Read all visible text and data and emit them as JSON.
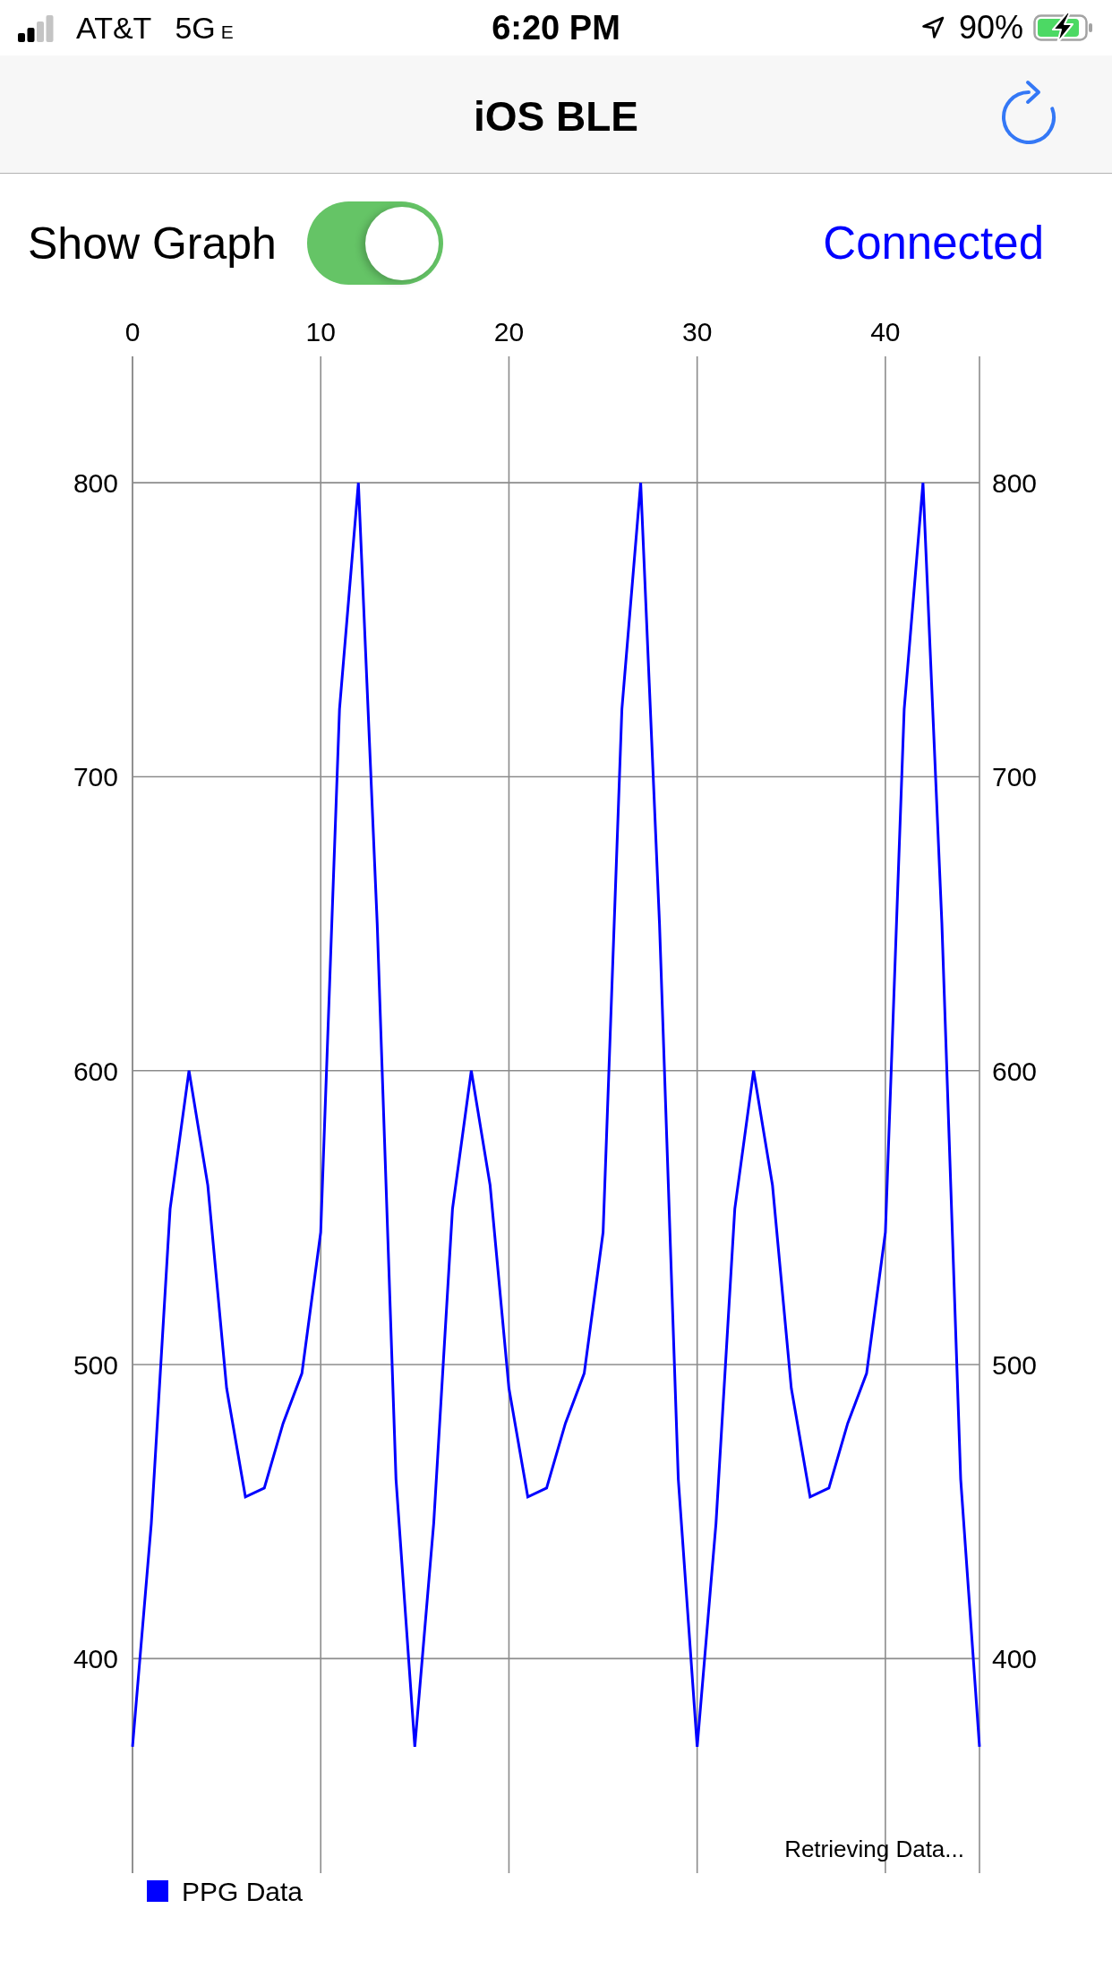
{
  "status_bar": {
    "carrier": "AT&T",
    "network": "5G",
    "network_suffix": "E",
    "time": "6:20 PM",
    "battery": "90%",
    "charging": true
  },
  "nav_bar": {
    "title": "iOS BLE"
  },
  "controls": {
    "show_graph": {
      "label": "Show Graph",
      "on": true
    },
    "connection_status": "Connected"
  },
  "graph": {
    "left_axis_labels": [
      "800",
      "700",
      "600",
      "500",
      "400"
    ],
    "right_axis_labels": [
      "800",
      "700",
      "600",
      "500",
      "400"
    ],
    "description": "Retrieving Data...",
    "chart_data": {
      "type": "line",
      "x": [
        0,
        1,
        2,
        3,
        4,
        5,
        6,
        7,
        8,
        9,
        10,
        11,
        12,
        13,
        14,
        15,
        16,
        17,
        18,
        19,
        20,
        21,
        22,
        23,
        24,
        25,
        26,
        27,
        28,
        29,
        30,
        31,
        32,
        33,
        34,
        35,
        36,
        37,
        38,
        39,
        40,
        41,
        42,
        43,
        44,
        45
      ],
      "series": [
        {
          "name": "PPG Data",
          "color": "#0000ff",
          "values": [
            370,
            446,
            553,
            600,
            561,
            492,
            455,
            458,
            480,
            497,
            545,
            723,
            800,
            650,
            461,
            370,
            446,
            553,
            600,
            561,
            492,
            455,
            458,
            480,
            497,
            545,
            723,
            800,
            650,
            461,
            370,
            446,
            553,
            600,
            561,
            492,
            455,
            458,
            480,
            497,
            545,
            723,
            800,
            650,
            461,
            370
          ]
        }
      ],
      "xlim": [
        0,
        45
      ],
      "ylim": [
        327,
        843
      ],
      "xticks": [
        0,
        10,
        20,
        30,
        40
      ],
      "yticks": [
        400,
        500,
        600,
        700,
        800
      ],
      "grid": true
    }
  }
}
